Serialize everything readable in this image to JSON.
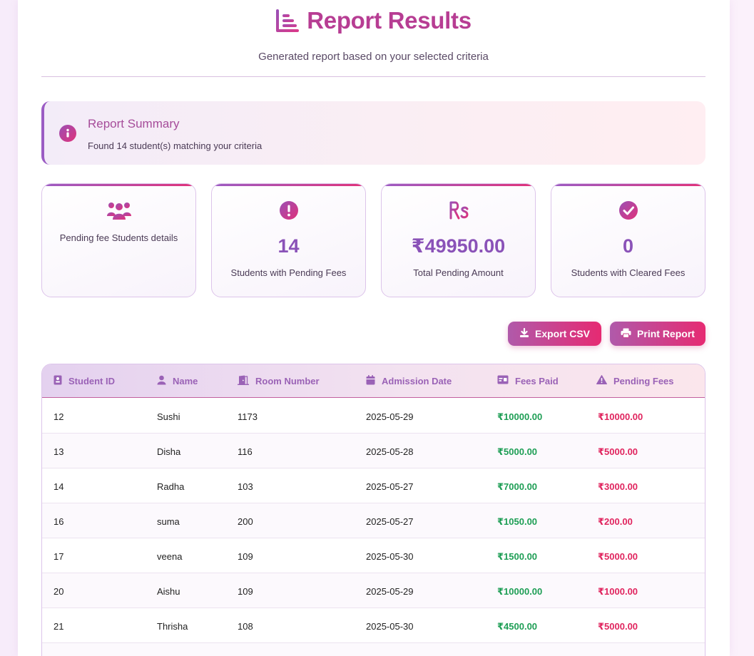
{
  "header": {
    "title": "Report Results",
    "subtitle": "Generated report based on your selected criteria"
  },
  "summary": {
    "title": "Report Summary",
    "text": "Found 14 student(s) matching your criteria"
  },
  "cards": [
    {
      "icon": "users-icon",
      "value": "",
      "label": "Pending fee Students details"
    },
    {
      "icon": "exclamation-circle-icon",
      "value": "14",
      "label": "Students with Pending Fees"
    },
    {
      "icon": "rupee-sign-icon",
      "value": "₹49950.00",
      "label": "Total Pending Amount"
    },
    {
      "icon": "check-circle-icon",
      "value": "0",
      "label": "Students with Cleared Fees"
    }
  ],
  "actions": {
    "export_label": "Export CSV",
    "print_label": "Print Report"
  },
  "table": {
    "columns": [
      {
        "label": "Student ID",
        "icon": "id-badge-icon"
      },
      {
        "label": "Name",
        "icon": "user-icon"
      },
      {
        "label": "Room Number",
        "icon": "door-icon"
      },
      {
        "label": "Admission Date",
        "icon": "calendar-icon"
      },
      {
        "label": "Fees Paid",
        "icon": "money-card-icon"
      },
      {
        "label": "Pending Fees",
        "icon": "warning-icon"
      }
    ],
    "rows": [
      [
        "12",
        "Sushi",
        "1173",
        "2025-05-29",
        "₹10000.00",
        "₹10000.00"
      ],
      [
        "13",
        "Disha",
        "116",
        "2025-05-28",
        "₹5000.00",
        "₹5000.00"
      ],
      [
        "14",
        "Radha",
        "103",
        "2025-05-27",
        "₹7000.00",
        "₹3000.00"
      ],
      [
        "16",
        "suma",
        "200",
        "2025-05-27",
        "₹1050.00",
        "₹200.00"
      ],
      [
        "17",
        "veena",
        "109",
        "2025-05-30",
        "₹1500.00",
        "₹5000.00"
      ],
      [
        "20",
        "Aishu",
        "109",
        "2025-05-29",
        "₹10000.00",
        "₹1000.00"
      ],
      [
        "21",
        "Thrisha",
        "108",
        "2025-05-30",
        "₹4500.00",
        "₹5000.00"
      ]
    ]
  },
  "colors": {
    "accent": "#b73d93",
    "paid": "#1e9e55",
    "pending": "#e0245e"
  }
}
